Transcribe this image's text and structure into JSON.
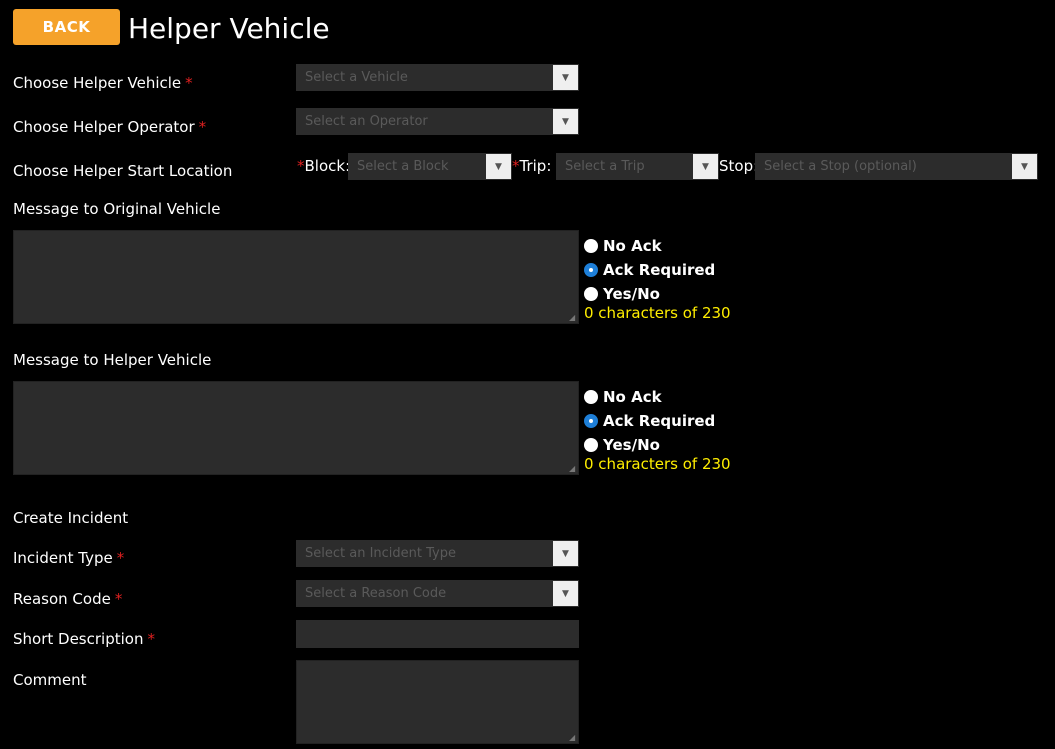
{
  "header": {
    "back_label": "BACK",
    "title": "Helper Vehicle"
  },
  "helper_vehicle": {
    "label": "Choose Helper Vehicle",
    "required": "*",
    "placeholder": "Select a Vehicle"
  },
  "helper_operator": {
    "label": "Choose Helper Operator",
    "required": "*",
    "placeholder": "Select an Operator"
  },
  "start_location": {
    "label": "Choose Helper Start Location",
    "block": {
      "star": "*",
      "label": "Block:",
      "placeholder": "Select a Block"
    },
    "trip": {
      "star": "*",
      "label": "Trip:",
      "placeholder": "Select a Trip"
    },
    "stop": {
      "label": "Stop:",
      "placeholder": "Select a Stop (optional)"
    }
  },
  "msg_original": {
    "label": "Message to Original Vehicle",
    "options": [
      "No Ack",
      "Ack Required",
      "Yes/No"
    ],
    "selected": "Ack Required",
    "counter": "0 characters of 230"
  },
  "msg_helper": {
    "label": "Message to Helper Vehicle",
    "options": [
      "No Ack",
      "Ack Required",
      "Yes/No"
    ],
    "selected": "Ack Required",
    "counter": "0 characters of 230"
  },
  "incident": {
    "section_label": "Create Incident",
    "type": {
      "label": "Incident Type",
      "required": "*",
      "placeholder": "Select an Incident Type"
    },
    "reason": {
      "label": "Reason Code",
      "required": "*",
      "placeholder": "Select a Reason Code"
    },
    "short_desc": {
      "label": "Short Description",
      "required": "*"
    },
    "comment": {
      "label": "Comment"
    }
  }
}
